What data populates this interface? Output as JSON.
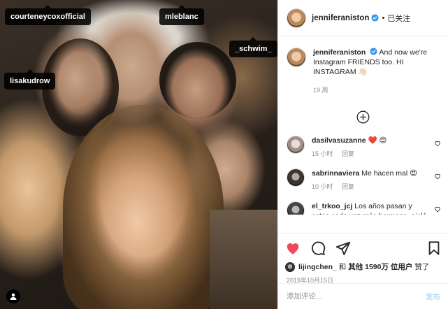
{
  "photo": {
    "tags": [
      {
        "label": "courteneycoxofficial"
      },
      {
        "label": "mleblanc"
      },
      {
        "label": "_schwim_"
      },
      {
        "label": "lisakudrow"
      }
    ]
  },
  "header": {
    "username": "jenniferaniston",
    "separator": "•",
    "follow_status": "已关注"
  },
  "caption": {
    "username": "jenniferaniston",
    "text": "And now we're Instagram FRIENDS too. HI INSTAGRAM 👋🏻",
    "time": "19 周"
  },
  "comments": [
    {
      "username": "dasilvasuzanne",
      "text": "❤️ 😍",
      "time": "15 小时",
      "reply": "回复"
    },
    {
      "username": "sabrinnaviera",
      "text": "Me hacen mal 😍",
      "time": "10 小时",
      "reply": "回复"
    },
    {
      "username": "el_trkoo_jcj",
      "text": "Los años pasan y estas cada vez más hermosa, ojalá vuelvan a hacer Friend\"s me divierte mucho",
      "time": "",
      "reply": ""
    }
  ],
  "likes": {
    "first_user": "lijingchen_",
    "connector": "和",
    "others": "其他 1590万 位用户",
    "suffix": "赞了"
  },
  "date": "2019年10月15日",
  "comment_box": {
    "placeholder": "添加评论...",
    "post_label": "发布"
  },
  "colors": {
    "like_red": "#ed4956",
    "verified_blue": "#3897f0",
    "post_button": "#b2dffc",
    "meta_gray": "#8e8e8e"
  }
}
